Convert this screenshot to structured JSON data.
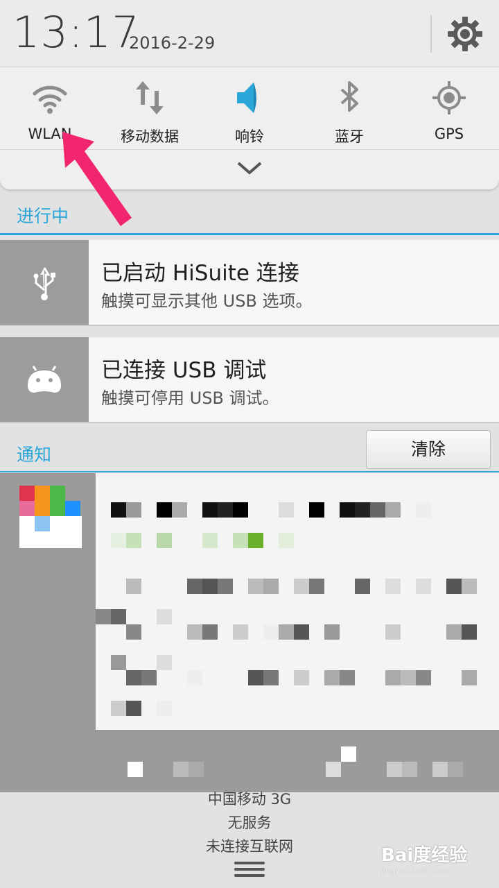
{
  "status": {
    "time": "13:17",
    "date": "2016-2-29"
  },
  "quick_settings": [
    {
      "label": "WLAN",
      "icon": "wifi-icon"
    },
    {
      "label": "移动数据",
      "icon": "mobile-data-icon"
    },
    {
      "label": "响铃",
      "icon": "ring-icon"
    },
    {
      "label": "蓝牙",
      "icon": "bluetooth-icon"
    },
    {
      "label": "GPS",
      "icon": "gps-icon"
    }
  ],
  "ongoing": {
    "title": "进行中",
    "items": [
      {
        "title": "已启动 HiSuite 连接",
        "subtitle": "触摸可显示其他 USB 选项。",
        "icon": "usb-icon"
      },
      {
        "title": "已连接 USB 调试",
        "subtitle": "触摸可停用 USB 调试。",
        "icon": "android-icon"
      }
    ]
  },
  "notifications": {
    "title": "通知",
    "clear_label": "清除"
  },
  "carrier": {
    "line1": "中国移动 3G",
    "line2": "无服务",
    "line3": "未连接互联网"
  },
  "watermark": {
    "text": "Bai度经验",
    "sub": "jingyan.baidu.com"
  },
  "colors": {
    "accent": "#2aa6d8",
    "arrow": "#f2266f"
  }
}
